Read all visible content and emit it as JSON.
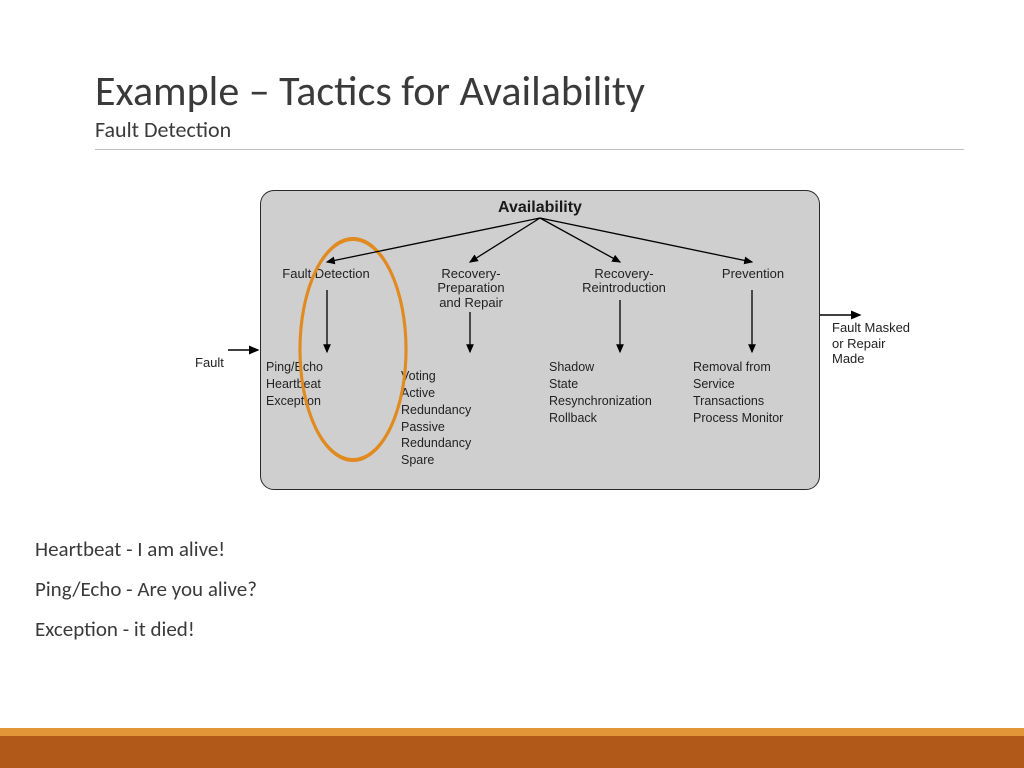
{
  "title": "Example – Tactics for Availability",
  "subtitle": "Fault Detection",
  "diagram": {
    "heading": "Availability",
    "input_label": "Fault",
    "output_label": "Fault Masked or Repair Made",
    "columns": [
      {
        "title": "Fault Detection",
        "items": [
          "Ping/Echo",
          "Heartbeat",
          "Exception"
        ]
      },
      {
        "title": "Recovery-\nPreparation\nand Repair",
        "items": [
          "Voting",
          "Active\n  Redundancy",
          "Passive\n  Redundancy",
          "Spare"
        ]
      },
      {
        "title": "Recovery-\nReintroduction",
        "items": [
          "Shadow",
          "State\n  Resynchronization",
          "Rollback"
        ]
      },
      {
        "title": "Prevention",
        "items": [
          "Removal from\n  Service",
          "Transactions",
          "Process Monitor"
        ]
      }
    ]
  },
  "notes": [
    "Heartbeat - I am alive!",
    "Ping/Echo - Are you alive?",
    "Exception - it died!"
  ],
  "colors": {
    "accent_light": "#e29637",
    "accent_dark": "#b15919",
    "highlight": "#e08a1f"
  }
}
